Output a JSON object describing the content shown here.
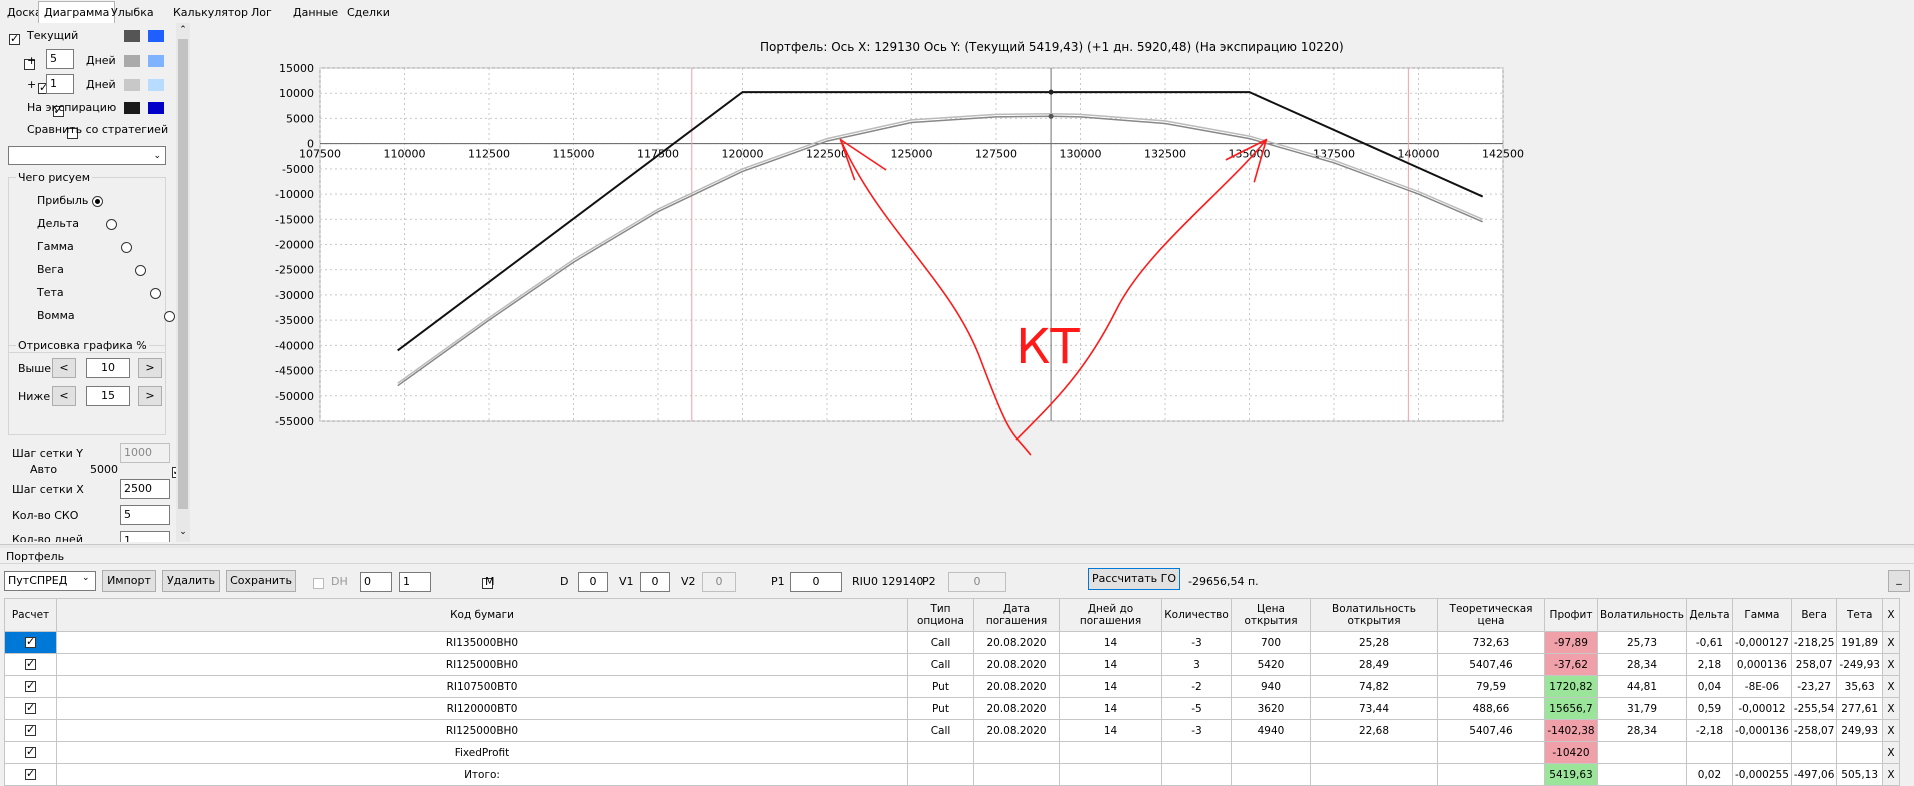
{
  "tabs": [
    "Доска",
    "Диаграмма",
    "Улыбка",
    "Калькулятор",
    "Лог",
    "Данные",
    "Сделки"
  ],
  "left": {
    "current_label": "Текущий",
    "plus1": "+",
    "plus1_days": "5",
    "days_label1": "Дней",
    "plus2": "+",
    "plus2_days": "1",
    "days_label2": "Дней",
    "expiry_label": "На экспирацию",
    "compare_label": "Сравнить со стратегией",
    "draw_group": "Чего рисуем",
    "options": [
      "Прибыль",
      "Дельта",
      "Гамма",
      "Вега",
      "Тета",
      "Вомма"
    ],
    "render_group": "Отрисовка графика %",
    "above_label": "Выше",
    "above_value": "10",
    "below_label": "Ниже",
    "below_value": "15",
    "grid_y_label": "Шаг сетки Y",
    "grid_y_value": "1000",
    "auto_label": "Авто",
    "auto_value": "5000",
    "grid_x_label": "Шаг сетки X",
    "grid_x_value": "2500",
    "sko_label": "Кол-во СКО",
    "sko_value": "5",
    "days_count_label": "Кол-во дней",
    "days_count_value": "1",
    "colors": [
      "#555555",
      "#1f5fff",
      "#aaaaaa",
      "#7fb2ff",
      "#c8c8c8",
      "#b8dcff",
      "#1a1a1a",
      "#0000c8"
    ]
  },
  "chart": {
    "header": "Портфель: Ось X:  129130 Ось Y:   (Текущий 5419,43)  (+1 дн.  5920,48)  (На экспирацию  10220)",
    "annotation": "КТ"
  },
  "chart_data": {
    "type": "line",
    "title": "Портфель: Ось X:  129130 Ось Y:   (Текущий 5419,43)  (+1 дн.  5920,48)  (На экспирацию  10220)",
    "xlim": [
      107500,
      142500
    ],
    "ylim": [
      -55000,
      15000
    ],
    "xticks": [
      107500,
      110000,
      112500,
      115000,
      117500,
      120000,
      122500,
      125000,
      127500,
      130000,
      132500,
      135000,
      137500,
      140000,
      142500
    ],
    "yticks": [
      15000,
      10000,
      5000,
      0,
      -5000,
      -10000,
      -15000,
      -20000,
      -25000,
      -30000,
      -35000,
      -40000,
      -45000,
      -50000,
      -55000
    ],
    "grid": true,
    "cursor_x": 129130,
    "vlines": [
      118500,
      139700
    ],
    "series": [
      {
        "id": "expiry",
        "color": "#111111",
        "x": [
          109800,
          120000,
          135000,
          141900
        ],
        "y": [
          -41000,
          10220,
          10220,
          -10500
        ]
      },
      {
        "id": "current",
        "color": "#888888",
        "x": [
          109800,
          112500,
          115000,
          117500,
          120000,
          122500,
          125000,
          127500,
          129130,
          130000,
          132500,
          135000,
          137500,
          140000,
          141900
        ],
        "y": [
          -48000,
          -35000,
          -23500,
          -13500,
          -5500,
          500,
          4200,
          5300,
          5419,
          5300,
          4000,
          1000,
          -3800,
          -10000,
          -15500
        ]
      },
      {
        "id": "plus1",
        "color": "#bbbbbb",
        "x": [
          109800,
          112500,
          115000,
          117500,
          120000,
          122500,
          125000,
          127500,
          129130,
          130000,
          132500,
          135000,
          137500,
          140000,
          141900
        ],
        "y": [
          -47500,
          -34500,
          -23000,
          -13000,
          -5000,
          1000,
          4700,
          5800,
          5920,
          5800,
          4500,
          1500,
          -3300,
          -9500,
          -15000
        ]
      }
    ]
  },
  "portfolio": {
    "title": "Портфель",
    "select_value": "ПутСПРЕД",
    "import_label": "Импорт",
    "delete_label": "Удалить",
    "save_label": "Сохранить",
    "dh_label": "DH",
    "dh_val1": "0",
    "dh_val2": "1",
    "m_label": "M",
    "d_label": "D",
    "d_value": "0",
    "v1_label": "V1",
    "v1_value": "0",
    "v2_label": "V2",
    "v2_value": "0",
    "p1_label": "P1",
    "p1_value": "0",
    "riu_label": "RIU0 129140",
    "p2_label": "P2",
    "p2_value": "0",
    "calc_go_label": "Рассчитать ГО",
    "go_value": "-29656,54 п.",
    "small_button": "_",
    "columns": [
      "Расчет",
      "Код бумаги",
      "Тип опциона",
      "Дата погашения",
      "Дней до погашения",
      "Количество",
      "Цена открытия",
      "Волатильность открытия",
      "Теоретическая цена",
      "Профит",
      "Волатильность",
      "Дельта",
      "Гамма",
      "Вега",
      "Тета",
      "X"
    ],
    "rows": [
      {
        "code": "RI135000BH0",
        "type": "Call",
        "date": "20.08.2020",
        "days": "14",
        "qty": "-3",
        "price": "700",
        "vol_open": "25,28",
        "theo": "732,63",
        "profit": "-97,89",
        "vol": "25,73",
        "delta": "-0,61",
        "gamma": "-0,000127",
        "vega": "-218,25",
        "theta": "191,89",
        "x": "X",
        "pcls": "neg"
      },
      {
        "code": "RI125000BH0",
        "type": "Call",
        "date": "20.08.2020",
        "days": "14",
        "qty": "3",
        "price": "5420",
        "vol_open": "28,49",
        "theo": "5407,46",
        "profit": "-37,62",
        "vol": "28,34",
        "delta": "2,18",
        "gamma": "0,000136",
        "vega": "258,07",
        "theta": "-249,93",
        "x": "X",
        "pcls": "neg"
      },
      {
        "code": "RI107500BT0",
        "type": "Put",
        "date": "20.08.2020",
        "days": "14",
        "qty": "-2",
        "price": "940",
        "vol_open": "74,82",
        "theo": "79,59",
        "profit": "1720,82",
        "vol": "44,81",
        "delta": "0,04",
        "gamma": "-8E-06",
        "vega": "-23,27",
        "theta": "35,63",
        "x": "X",
        "pcls": "pos"
      },
      {
        "code": "RI120000BT0",
        "type": "Put",
        "date": "20.08.2020",
        "days": "14",
        "qty": "-5",
        "price": "3620",
        "vol_open": "73,44",
        "theo": "488,66",
        "profit": "15656,7",
        "vol": "31,79",
        "delta": "0,59",
        "gamma": "-0,00012",
        "vega": "-255,54",
        "theta": "277,61",
        "x": "X",
        "pcls": "pos"
      },
      {
        "code": "RI125000BH0",
        "type": "Call",
        "date": "20.08.2020",
        "days": "14",
        "qty": "-3",
        "price": "4940",
        "vol_open": "22,68",
        "theo": "5407,46",
        "profit": "-1402,38",
        "vol": "28,34",
        "delta": "-2,18",
        "gamma": "-0,000136",
        "vega": "-258,07",
        "theta": "249,93",
        "x": "X",
        "pcls": "neg"
      },
      {
        "code": "FixedProfit",
        "type": "",
        "date": "",
        "days": "",
        "qty": "",
        "price": "",
        "vol_open": "",
        "theo": "",
        "profit": "-10420",
        "vol": "",
        "delta": "",
        "gamma": "",
        "vega": "",
        "theta": "",
        "x": "X",
        "pcls": "neg"
      },
      {
        "code": "Итого:",
        "type": "",
        "date": "",
        "days": "",
        "qty": "",
        "price": "",
        "vol_open": "",
        "theo": "",
        "profit": "5419,63",
        "vol": "",
        "delta": "0,02",
        "gamma": "-0,000255",
        "vega": "-497,06",
        "theta": "505,13",
        "x": "X",
        "pcls": "pos"
      }
    ]
  }
}
